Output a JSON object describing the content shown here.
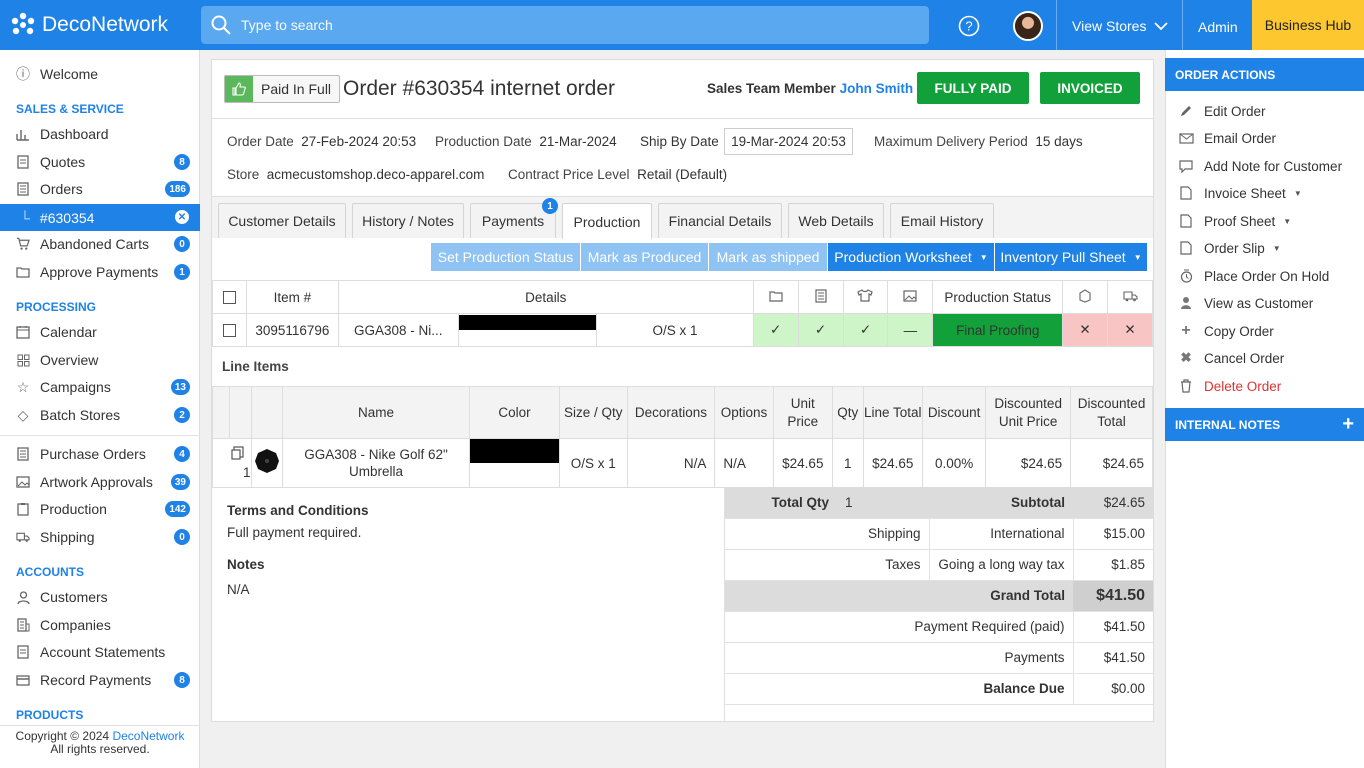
{
  "topbar": {
    "brand": "DecoNetwork",
    "search_placeholder": "Type to search",
    "view_stores": "View Stores",
    "admin": "Admin",
    "business_hub": "Business Hub"
  },
  "sidebar": {
    "welcome": "Welcome",
    "sections": {
      "sales": "SALES & SERVICE",
      "processing": "PROCESSING",
      "accounts": "ACCOUNTS",
      "products": "PRODUCTS"
    },
    "sales_items": [
      {
        "label": "Dashboard",
        "icon": "bar-chart-icon"
      },
      {
        "label": "Quotes",
        "badge": "8",
        "icon": "document-icon"
      },
      {
        "label": "Orders",
        "badge": "186",
        "icon": "document-list-icon"
      },
      {
        "label": "#630354",
        "active": true
      },
      {
        "label": "Abandoned Carts",
        "badge": "0",
        "icon": "cart-icon"
      },
      {
        "label": "Approve Payments",
        "badge": "1",
        "icon": "folder-icon"
      }
    ],
    "processing_items": [
      {
        "label": "Calendar"
      },
      {
        "label": "Overview"
      },
      {
        "label": "Campaigns",
        "badge": "13"
      },
      {
        "label": "Batch Stores",
        "badge": "2"
      },
      {
        "label": "Purchase Orders",
        "badge": "4"
      },
      {
        "label": "Artwork Approvals",
        "badge": "39"
      },
      {
        "label": "Production",
        "badge": "142"
      },
      {
        "label": "Shipping",
        "badge": "0"
      }
    ],
    "accounts_items": [
      {
        "label": "Customers"
      },
      {
        "label": "Companies"
      },
      {
        "label": "Account Statements"
      },
      {
        "label": "Record Payments",
        "badge": "8"
      }
    ],
    "copyright": "Copyright © 2024",
    "copyright_brand": "DecoNetwork",
    "rights": "All rights reserved."
  },
  "order": {
    "paid_label": "Paid In Full",
    "title": "Order #630354 internet order",
    "sales_team_label": "Sales Team Member",
    "sales_team_name": "John Smith",
    "fully_paid": "FULLY PAID",
    "invoiced": "INVOICED",
    "order_date_label": "Order Date",
    "order_date": "27-Feb-2024 20:53",
    "production_date_label": "Production Date",
    "production_date": "21-Mar-2024",
    "ship_by_label": "Ship By Date",
    "ship_by": "19-Mar-2024 20:53",
    "max_delivery_label": "Maximum Delivery Period",
    "max_delivery": "15 days",
    "store_label": "Store",
    "store": "acmecustomshop.deco-apparel.com",
    "price_level_label": "Contract Price Level",
    "price_level": "Retail (Default)"
  },
  "tabs": [
    "Customer Details",
    "History / Notes",
    "Payments",
    "Production",
    "Financial Details",
    "Web Details",
    "Email History"
  ],
  "payments_badge": "1",
  "actions": {
    "set_status": "Set Production Status",
    "mark_produced": "Mark as Produced",
    "mark_shipped": "Mark as shipped",
    "worksheet": "Production Worksheet",
    "pull_sheet": "Inventory Pull Sheet"
  },
  "production_table": {
    "headers": {
      "item": "Item #",
      "details": "Details",
      "status": "Production Status"
    },
    "row": {
      "item": "3095116796",
      "product": "GGA308 - Ni...",
      "size": "O/S x 1",
      "dash": "—",
      "status": "Final Proofing"
    }
  },
  "line_items": {
    "title": "Line Items",
    "headers": [
      "Name",
      "Color",
      "Size / Qty",
      "Decorations",
      "Options",
      "Unit Price",
      "Qty",
      "Line Total",
      "Discount",
      "Discounted Unit Price",
      "Discounted Total"
    ],
    "row": {
      "num": "1",
      "name": "GGA308 - Nike Golf 62\" Umbrella",
      "size": "O/S x 1",
      "decorations": "N/A",
      "options": "N/A",
      "unit_price": "$24.65",
      "qty": "1",
      "line_total": "$24.65",
      "discount": "0.00%",
      "disc_unit": "$24.65",
      "disc_total": "$24.65"
    }
  },
  "terms": {
    "title": "Terms and Conditions",
    "text": "Full payment required.",
    "notes_title": "Notes",
    "notes": "N/A"
  },
  "totals": {
    "total_qty_label": "Total Qty",
    "total_qty": "1",
    "subtotal_label": "Subtotal",
    "subtotal": "$24.65",
    "shipping_label": "Shipping",
    "shipping_method": "International",
    "shipping": "$15.00",
    "taxes_label": "Taxes",
    "tax_name": "Going a long way tax",
    "taxes": "$1.85",
    "grand_total_label": "Grand Total",
    "grand_total": "$41.50",
    "payment_required_label": "Payment Required (paid)",
    "payment_required": "$41.50",
    "payments_label": "Payments",
    "payments": "$41.50",
    "balance_label": "Balance Due",
    "balance": "$0.00"
  },
  "right_panel": {
    "order_actions": "ORDER ACTIONS",
    "internal_notes": "INTERNAL NOTES",
    "items": [
      {
        "label": "Edit Order",
        "icon": "pencil-icon"
      },
      {
        "label": "Email Order",
        "icon": "envelope-icon"
      },
      {
        "label": "Add Note for Customer",
        "icon": "comment-icon"
      },
      {
        "label": "Invoice Sheet",
        "icon": "file-icon",
        "dropdown": true
      },
      {
        "label": "Proof Sheet",
        "icon": "file-icon",
        "dropdown": true
      },
      {
        "label": "Order Slip",
        "icon": "file-icon",
        "dropdown": true
      },
      {
        "label": "Place Order On Hold",
        "icon": "hold-icon"
      },
      {
        "label": "View as Customer",
        "icon": "user-icon"
      },
      {
        "label": "Copy Order",
        "icon": "plus-icon"
      },
      {
        "label": "Cancel Order",
        "icon": "x-icon"
      },
      {
        "label": "Delete Order",
        "icon": "trash-icon",
        "danger": true
      }
    ]
  },
  "colors": {
    "primary": "#1e82e6",
    "success": "#12a03a",
    "business_hub": "#fdc82f"
  }
}
